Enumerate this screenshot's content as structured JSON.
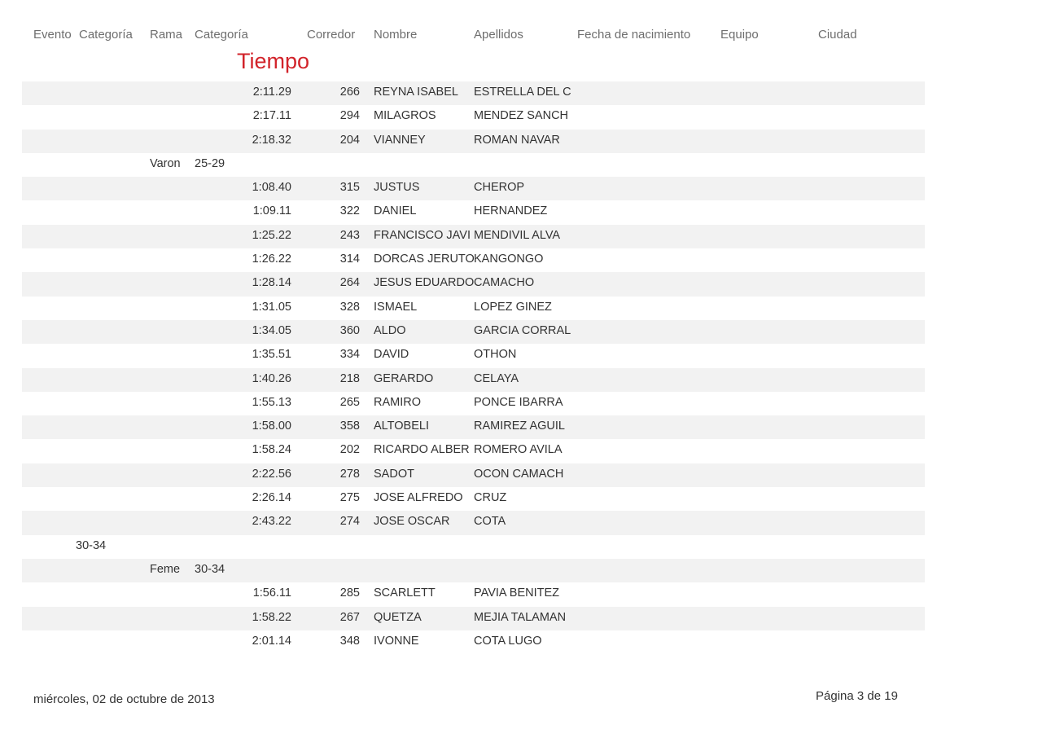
{
  "header": {
    "evento": "Evento",
    "categoria1": "Categoría",
    "rama": "Rama",
    "categoria2": "Categoría",
    "corredor": "Corredor",
    "nombre": "Nombre",
    "apellidos": "Apellidos",
    "fecha_nacimiento": "Fecha de nacimiento",
    "equipo": "Equipo",
    "ciudad": "Ciudad",
    "tiempo": "Tiempo"
  },
  "rows": [
    {
      "ev_cat": "",
      "rama": "",
      "categoria": "",
      "tiempo": "2:11.29",
      "corredor": "266",
      "nombre": "REYNA ISABEL",
      "apellidos": "ESTRELLA DEL C"
    },
    {
      "ev_cat": "",
      "rama": "",
      "categoria": "",
      "tiempo": "2:17.11",
      "corredor": "294",
      "nombre": "MILAGROS",
      "apellidos": "MENDEZ SANCH"
    },
    {
      "ev_cat": "",
      "rama": "",
      "categoria": "",
      "tiempo": "2:18.32",
      "corredor": "204",
      "nombre": "VIANNEY",
      "apellidos": "ROMAN NAVAR"
    },
    {
      "ev_cat": "",
      "rama": "Varon",
      "categoria": "25-29",
      "tiempo": "",
      "corredor": "",
      "nombre": "",
      "apellidos": ""
    },
    {
      "ev_cat": "",
      "rama": "",
      "categoria": "",
      "tiempo": "1:08.40",
      "corredor": "315",
      "nombre": "JUSTUS",
      "apellidos": "CHEROP"
    },
    {
      "ev_cat": "",
      "rama": "",
      "categoria": "",
      "tiempo": "1:09.11",
      "corredor": "322",
      "nombre": "DANIEL",
      "apellidos": "HERNANDEZ"
    },
    {
      "ev_cat": "",
      "rama": "",
      "categoria": "",
      "tiempo": "1:25.22",
      "corredor": "243",
      "nombre": "FRANCISCO JAVI",
      "apellidos": "MENDIVIL ALVA"
    },
    {
      "ev_cat": "",
      "rama": "",
      "categoria": "",
      "tiempo": "1:26.22",
      "corredor": "314",
      "nombre": "DORCAS JERUTO",
      "apellidos": "KANGONGO"
    },
    {
      "ev_cat": "",
      "rama": "",
      "categoria": "",
      "tiempo": "1:28.14",
      "corredor": "264",
      "nombre": "JESUS EDUARDO",
      "apellidos": "CAMACHO"
    },
    {
      "ev_cat": "",
      "rama": "",
      "categoria": "",
      "tiempo": "1:31.05",
      "corredor": "328",
      "nombre": "ISMAEL",
      "apellidos": "LOPEZ GINEZ"
    },
    {
      "ev_cat": "",
      "rama": "",
      "categoria": "",
      "tiempo": "1:34.05",
      "corredor": "360",
      "nombre": "ALDO",
      "apellidos": "GARCIA CORRAL"
    },
    {
      "ev_cat": "",
      "rama": "",
      "categoria": "",
      "tiempo": "1:35.51",
      "corredor": "334",
      "nombre": "DAVID",
      "apellidos": "OTHON"
    },
    {
      "ev_cat": "",
      "rama": "",
      "categoria": "",
      "tiempo": "1:40.26",
      "corredor": "218",
      "nombre": "GERARDO",
      "apellidos": "CELAYA"
    },
    {
      "ev_cat": "",
      "rama": "",
      "categoria": "",
      "tiempo": "1:55.13",
      "corredor": "265",
      "nombre": "RAMIRO",
      "apellidos": "PONCE IBARRA"
    },
    {
      "ev_cat": "",
      "rama": "",
      "categoria": "",
      "tiempo": "1:58.00",
      "corredor": "358",
      "nombre": "ALTOBELI",
      "apellidos": "RAMIREZ AGUIL"
    },
    {
      "ev_cat": "",
      "rama": "",
      "categoria": "",
      "tiempo": "1:58.24",
      "corredor": "202",
      "nombre": "RICARDO ALBER",
      "apellidos": "ROMERO AVILA"
    },
    {
      "ev_cat": "",
      "rama": "",
      "categoria": "",
      "tiempo": "2:22.56",
      "corredor": "278",
      "nombre": "SADOT",
      "apellidos": "OCON CAMACH"
    },
    {
      "ev_cat": "",
      "rama": "",
      "categoria": "",
      "tiempo": "2:26.14",
      "corredor": "275",
      "nombre": "JOSE ALFREDO",
      "apellidos": "CRUZ"
    },
    {
      "ev_cat": "",
      "rama": "",
      "categoria": "",
      "tiempo": "2:43.22",
      "corredor": "274",
      "nombre": "JOSE OSCAR",
      "apellidos": "COTA"
    },
    {
      "ev_cat": "30-34",
      "rama": "",
      "categoria": "",
      "tiempo": "",
      "corredor": "",
      "nombre": "",
      "apellidos": ""
    },
    {
      "ev_cat": "",
      "rama": "Feme",
      "categoria": "30-34",
      "tiempo": "",
      "corredor": "",
      "nombre": "",
      "apellidos": ""
    },
    {
      "ev_cat": "",
      "rama": "",
      "categoria": "",
      "tiempo": "1:56.11",
      "corredor": "285",
      "nombre": "SCARLETT",
      "apellidos": "PAVIA BENITEZ"
    },
    {
      "ev_cat": "",
      "rama": "",
      "categoria": "",
      "tiempo": "1:58.22",
      "corredor": "267",
      "nombre": "QUETZA",
      "apellidos": "MEJIA TALAMAN"
    },
    {
      "ev_cat": "",
      "rama": "",
      "categoria": "",
      "tiempo": "2:01.14",
      "corredor": "348",
      "nombre": "IVONNE",
      "apellidos": "COTA LUGO"
    }
  ],
  "footer": {
    "date": "miércoles, 02 de octubre de 2013",
    "page": "Página 3 de 19"
  }
}
